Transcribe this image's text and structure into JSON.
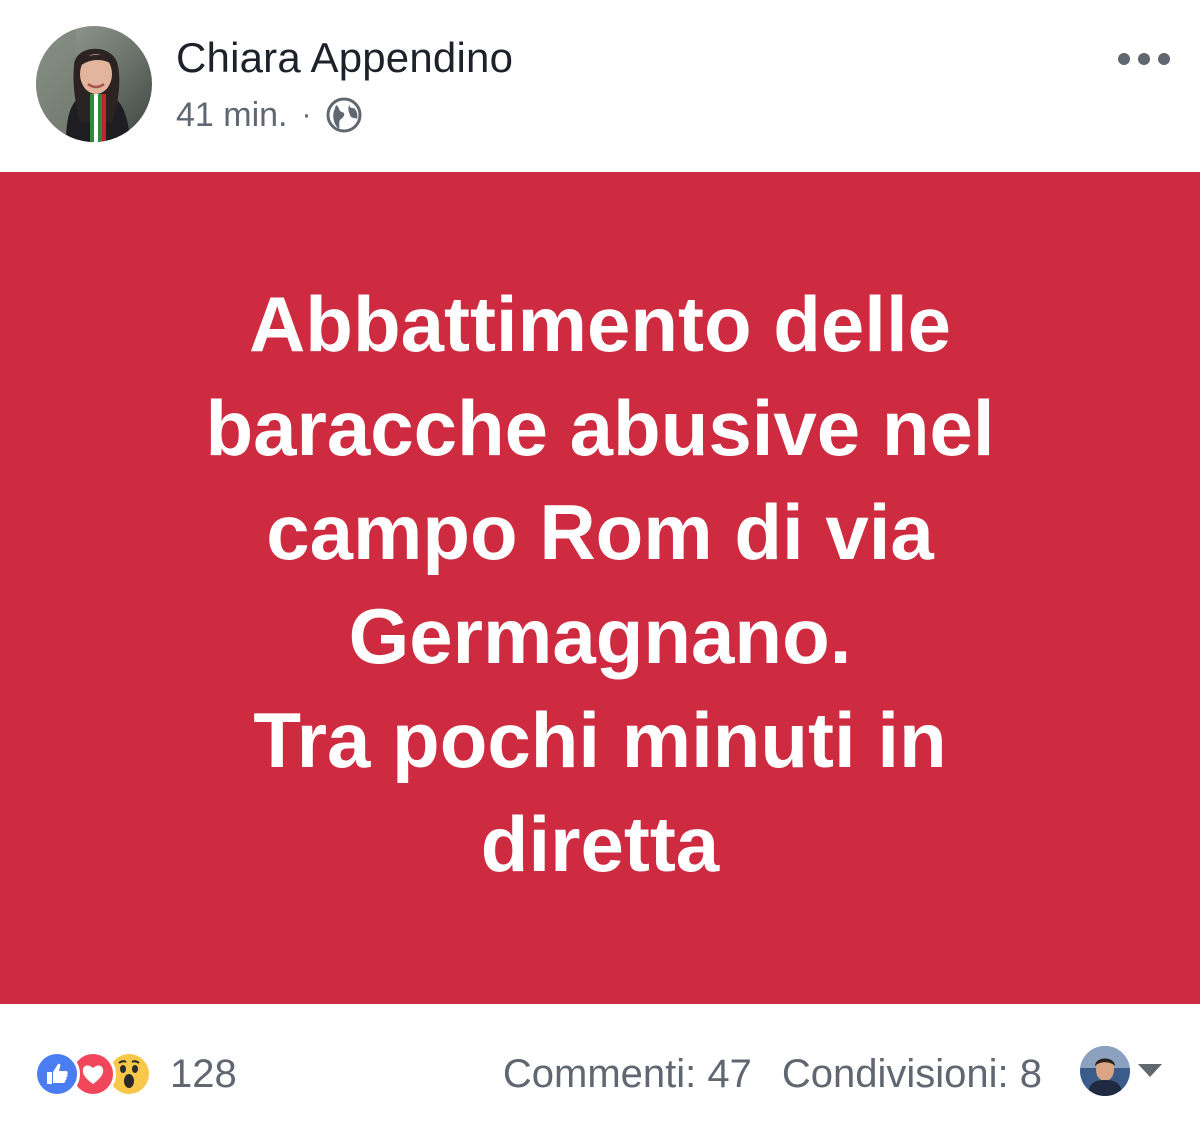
{
  "post": {
    "author_name": "Chiara Appendino",
    "timestamp": "41 min.",
    "separator": "·",
    "privacy_icon": "globe-icon",
    "more_icon": "more-options-icon",
    "card": {
      "background_color": "#ce2b40",
      "text_color": "#ffffff",
      "text": "Abbattimento delle\nbaracche abusive nel\ncampo Rom di via\nGermagnano.\nTra pochi minuti in\ndiretta"
    },
    "footer": {
      "reaction_icons": [
        "like-icon",
        "love-icon",
        "wow-icon"
      ],
      "reaction_count": "128",
      "comments": "Commenti: 47",
      "shares": "Condivisioni: 8",
      "viewer_icon": "avatar",
      "dropdown_icon": "caret-down-icon"
    }
  }
}
